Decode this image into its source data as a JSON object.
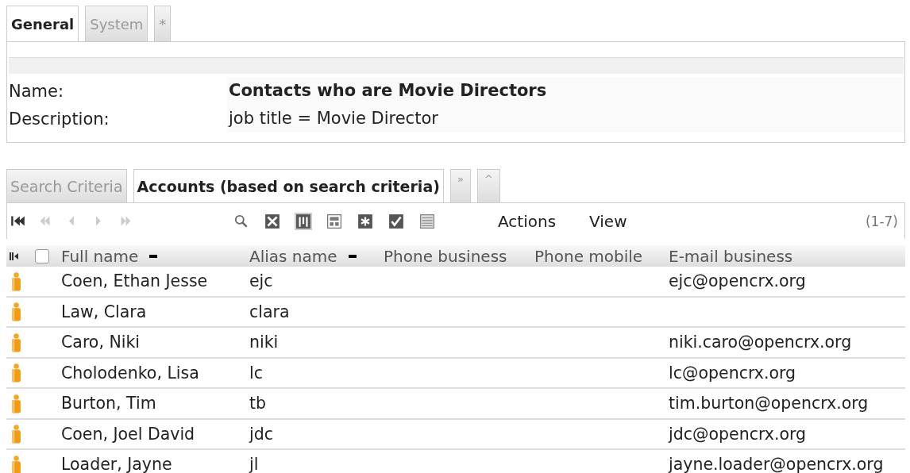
{
  "top_tabs": [
    {
      "label": "General",
      "selected": true
    },
    {
      "label": "System",
      "selected": false
    },
    {
      "label": "*",
      "selected": false
    }
  ],
  "fields": [
    {
      "label": "Name:",
      "value": "Contacts who are Movie Directors",
      "kind": "bold"
    },
    {
      "label": "Description:",
      "value": "job title = Movie Director",
      "kind": "plain"
    }
  ],
  "list_tabs": [
    {
      "label": "Search Criteria",
      "selected": false
    },
    {
      "label": "Accounts (based on search criteria)",
      "selected": true
    },
    {
      "label": "»",
      "selected": false
    },
    {
      "label": "^",
      "selected": false
    }
  ],
  "toolbar": {
    "nav": [
      {
        "kind": "first",
        "disabled": false
      },
      {
        "kind": "fast-back",
        "disabled": true
      },
      {
        "kind": "back",
        "disabled": true
      },
      {
        "kind": "forward",
        "disabled": true
      },
      {
        "kind": "fast-forward",
        "disabled": true
      }
    ],
    "tools": [
      {
        "kind": "search",
        "selected": false
      },
      {
        "kind": "cross",
        "selected": false
      },
      {
        "kind": "columns",
        "selected": true
      },
      {
        "kind": "form",
        "selected": false
      },
      {
        "kind": "asterisk",
        "selected": false
      },
      {
        "kind": "check",
        "selected": false
      },
      {
        "kind": "list",
        "selected": false
      }
    ],
    "menus": [
      "Actions",
      "View"
    ],
    "count": "(1-7)"
  },
  "table": {
    "select_all_checked": false,
    "columns": [
      {
        "label": "Full name",
        "sorted": true
      },
      {
        "label": "Alias name",
        "sorted": true
      },
      {
        "label": "Phone business",
        "sorted": false
      },
      {
        "label": "Phone mobile",
        "sorted": false
      },
      {
        "label": "E-mail business",
        "sorted": false
      }
    ],
    "rows": [
      {
        "cells": [
          "Coen, Ethan Jesse",
          "ejc",
          "",
          "",
          "ejc@opencrx.org"
        ]
      },
      {
        "cells": [
          "Law, Clara",
          "clara",
          "",
          "",
          ""
        ]
      },
      {
        "cells": [
          "Caro, Niki",
          "niki",
          "",
          "",
          "niki.caro@opencrx.org"
        ]
      },
      {
        "cells": [
          "Cholodenko, Lisa",
          "lc",
          "",
          "",
          "lc@opencrx.org"
        ]
      },
      {
        "cells": [
          "Burton, Tim",
          "tb",
          "",
          "",
          "tim.burton@opencrx.org"
        ]
      },
      {
        "cells": [
          "Coen, Joel David",
          "jdc",
          "",
          "",
          "jdc@opencrx.org"
        ]
      },
      {
        "cells": [
          "Loader, Jayne",
          "jl",
          "",
          "",
          "jayne.loader@opencrx.org"
        ]
      }
    ]
  }
}
